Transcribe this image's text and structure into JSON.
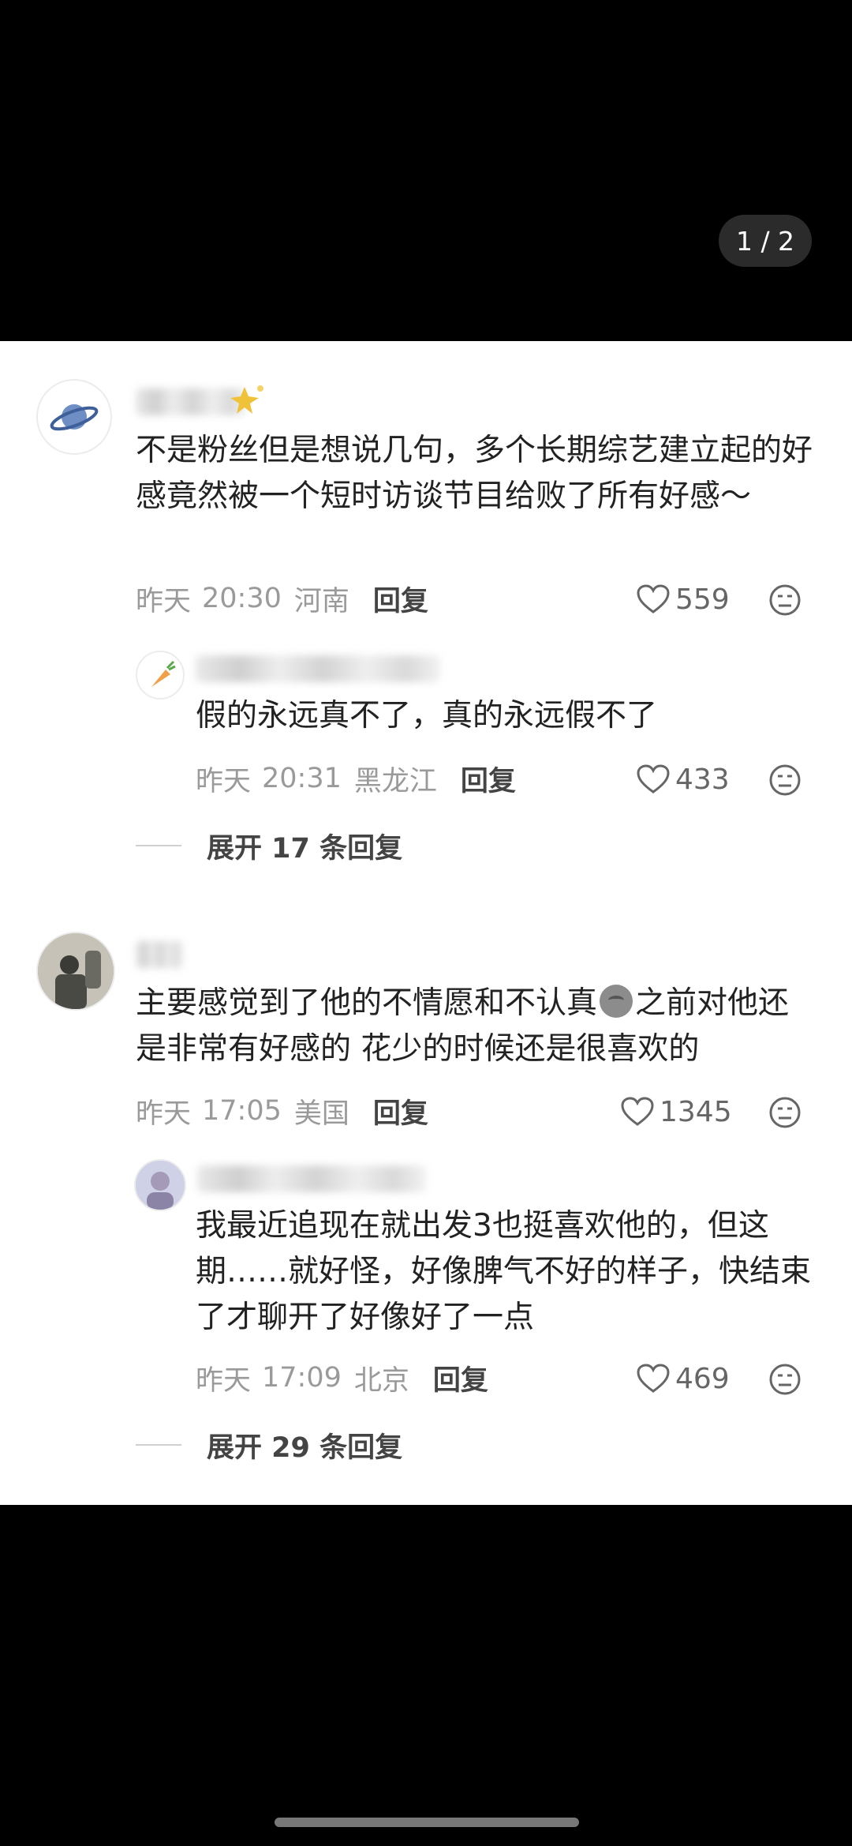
{
  "viewer": {
    "page_counter": "1 / 2"
  },
  "comments": [
    {
      "text": "不是粉丝但是想说几句，多个长期综艺建立起的好感竟然被一个短时访谈节目给败了所有好感～",
      "date": "昨天",
      "time": "20:30",
      "location": "河南",
      "reply_label": "回复",
      "likes": "559",
      "avatar_icon": "planet-icon",
      "replies": [
        {
          "text": "假的永远真不了，真的永远假不了",
          "date": "昨天",
          "time": "20:31",
          "location": "黑龙江",
          "reply_label": "回复",
          "likes": "433",
          "avatar_icon": "carrot-icon"
        }
      ],
      "expand_label": "展开 17 条回复"
    },
    {
      "text_before_emoji": "主要感觉到了他的不情愿和不认真",
      "emoji_icon": "frown-emoji-icon",
      "text_after_emoji": "之前对他还是非常有好感的 花少的时候还是很喜欢的",
      "date": "昨天",
      "time": "17:05",
      "location": "美国",
      "reply_label": "回复",
      "likes": "1345",
      "avatar_icon": "figure-photo-avatar",
      "replies": [
        {
          "text": "我最近追现在就出发3也挺喜欢他的，但这期……就好怪，好像脾气不好的样子，快结束了才聊开了好像好了一点",
          "date": "昨天",
          "time": "17:09",
          "location": "北京",
          "reply_label": "回复",
          "likes": "469",
          "avatar_icon": "photo-avatar"
        }
      ],
      "expand_label": "展开 29 条回复"
    }
  ],
  "colors": {
    "background": "#000000",
    "sheet": "#ffffff",
    "text": "#222222",
    "meta": "#9a9a9a"
  }
}
